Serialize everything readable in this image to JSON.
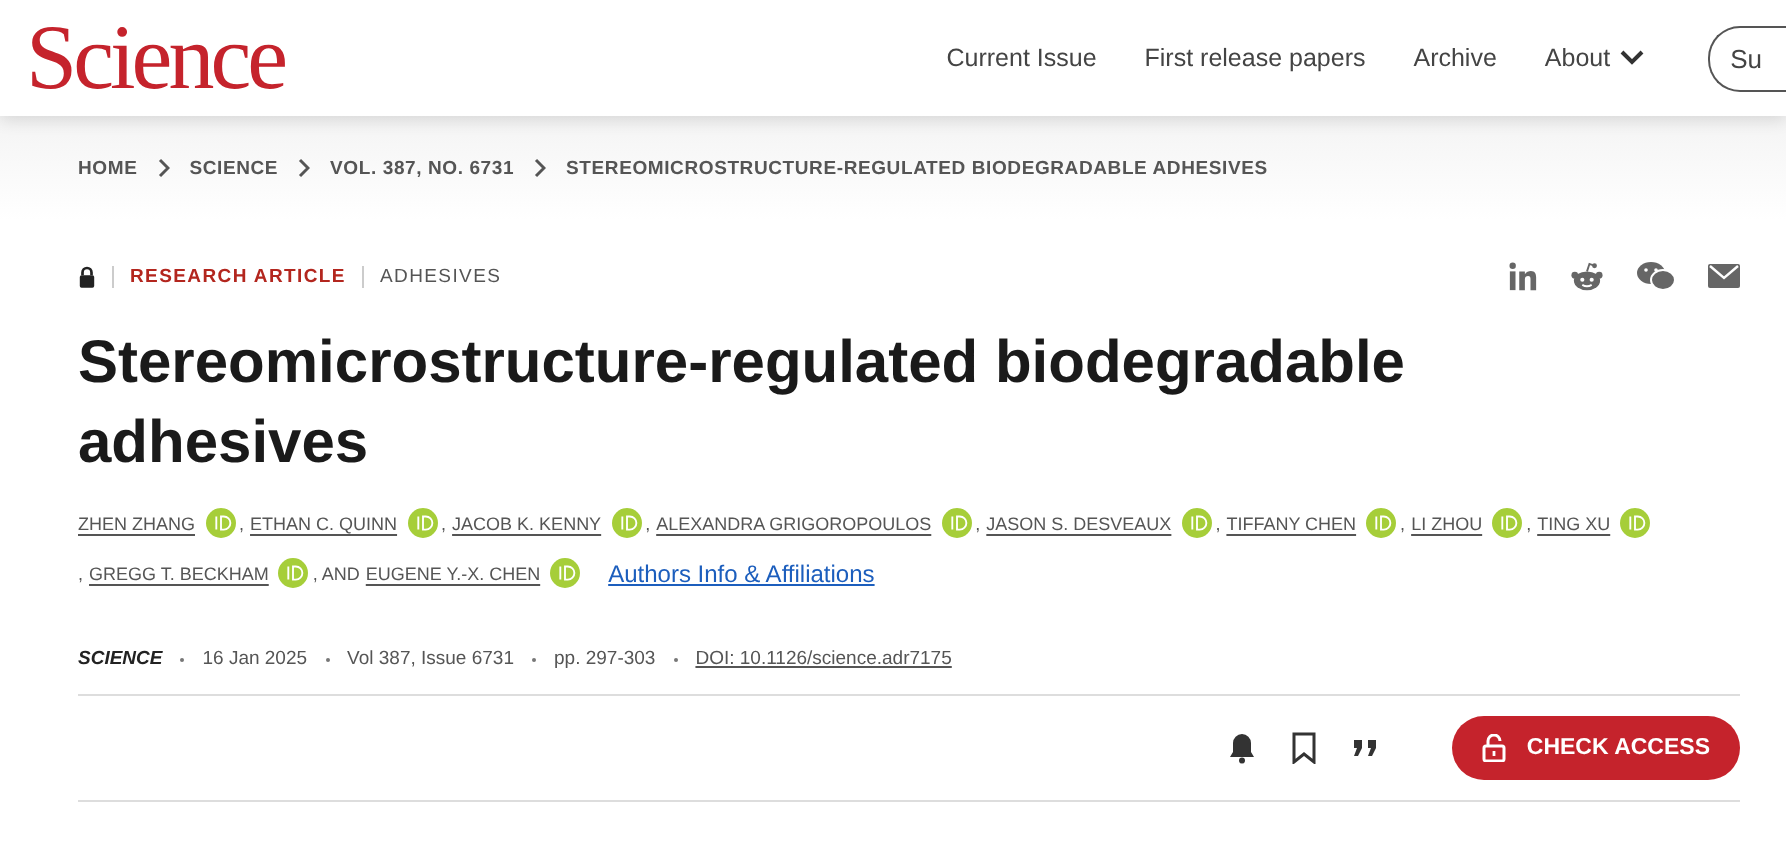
{
  "header": {
    "logo": "Science",
    "nav": [
      {
        "label": "Current Issue",
        "kind": "link"
      },
      {
        "label": "First release papers",
        "kind": "link"
      },
      {
        "label": "Archive",
        "kind": "link"
      },
      {
        "label": "About",
        "kind": "menu"
      }
    ],
    "subscribe": "Su"
  },
  "breadcrumbs": [
    "HOME",
    "SCIENCE",
    "VOL. 387, NO. 6731",
    "STEREOMICROSTRUCTURE-REGULATED BIODEGRADABLE ADHESIVES"
  ],
  "article": {
    "locked": true,
    "type": "RESEARCH ARTICLE",
    "section": "ADHESIVES",
    "title": "Stereomicrostructure-regulated biodegradable adhesives",
    "authors": [
      {
        "name": "ZHEN ZHANG",
        "orcid": true
      },
      {
        "sep": ",",
        "name": "ETHAN C. QUINN",
        "orcid": true
      },
      {
        "sep": ",",
        "name": "JACOB K. KENNY",
        "orcid": true
      },
      {
        "sep": ",",
        "name": "ALEXANDRA GRIGOROPOULOS",
        "orcid": true
      },
      {
        "sep": ",",
        "name": "JASON S. DESVEAUX",
        "orcid": true
      },
      {
        "sep": ",",
        "name": "TIFFANY CHEN",
        "orcid": true
      },
      {
        "sep": ",",
        "name": "LI ZHOU",
        "orcid": true
      },
      {
        "sep": ",",
        "name": "TING XU",
        "orcid": true
      },
      {
        "sep": ",",
        "name": "GREGG T. BECKHAM",
        "orcid": true
      },
      {
        "sep": ", AND",
        "name": "EUGENE Y.-X. CHEN",
        "orcid": true
      }
    ],
    "affiliations_link": "Authors Info & Affiliations",
    "meta": {
      "journal": "SCIENCE",
      "date": "16 Jan 2025",
      "volume": "Vol 387, Issue 6731",
      "pages": "pp. 297-303",
      "doi": "DOI: 10.1126/science.adr7175"
    },
    "access_button": "CHECK ACCESS"
  }
}
